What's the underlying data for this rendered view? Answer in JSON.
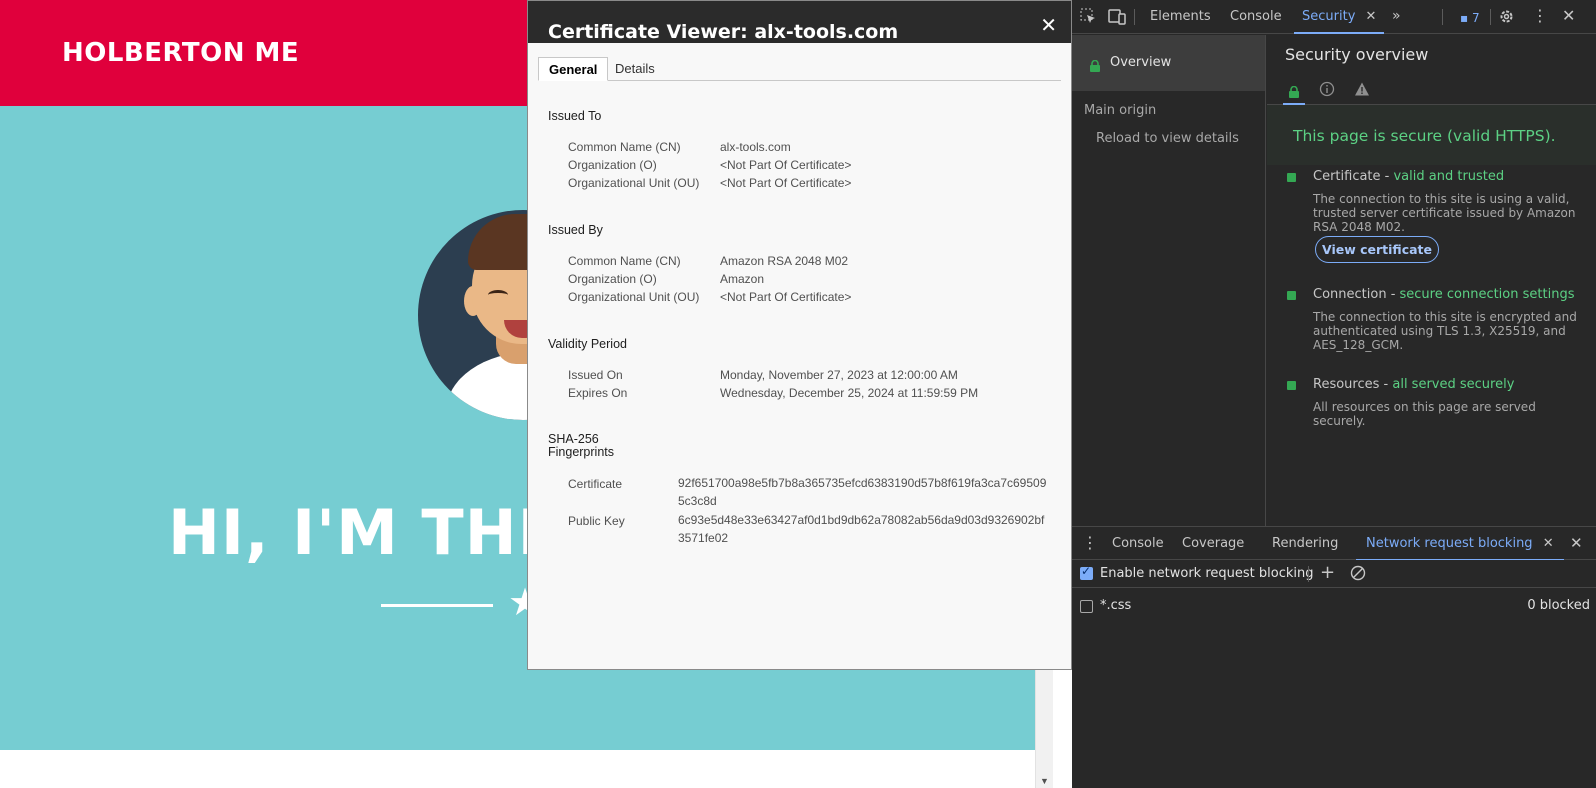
{
  "website": {
    "brand": "HOLBERTON ME",
    "hero_title": "HI, I'M THE"
  },
  "cert_viewer": {
    "title": "Certificate Viewer: alx-tools.com",
    "tabs": [
      "General",
      "Details"
    ],
    "issued_to": {
      "heading": "Issued To",
      "rows": [
        {
          "key": "Common Name (CN)",
          "value": "alx-tools.com"
        },
        {
          "key": "Organization (O)",
          "value": "<Not Part Of Certificate>"
        },
        {
          "key": "Organizational Unit (OU)",
          "value": "<Not Part Of Certificate>"
        }
      ]
    },
    "issued_by": {
      "heading": "Issued By",
      "rows": [
        {
          "key": "Common Name (CN)",
          "value": "Amazon RSA 2048 M02"
        },
        {
          "key": "Organization (O)",
          "value": "Amazon"
        },
        {
          "key": "Organizational Unit (OU)",
          "value": "<Not Part Of Certificate>"
        }
      ]
    },
    "validity": {
      "heading": "Validity Period",
      "rows": [
        {
          "key": "Issued On",
          "value": "Monday, November 27, 2023 at 12:00:00 AM"
        },
        {
          "key": "Expires On",
          "value": "Wednesday, December 25, 2024 at 11:59:59 PM"
        }
      ]
    },
    "fingerprints": {
      "heading_line1": "SHA-256",
      "heading_line2": "Fingerprints",
      "rows": [
        {
          "key": "Certificate",
          "value": "92f651700a98e5fb7b8a365735efcd6383190d57b8f619fa3ca7c695095c3c8d"
        },
        {
          "key": "Public Key",
          "value": "6c93e5d48e33e63427af0d1bd9db62a78082ab56da9d03d9326902bf3571fe02"
        }
      ]
    }
  },
  "devtools": {
    "tabs": [
      "Elements",
      "Console",
      "Security"
    ],
    "issues_count": "7",
    "sidebar": {
      "overview": "Overview",
      "main_origin": "Main origin",
      "reload": "Reload to view details"
    },
    "overview": {
      "title": "Security overview",
      "secure_message": "This page is secure (valid HTTPS).",
      "certificate": {
        "label": "Certificate - ",
        "status": "valid and trusted",
        "desc": "The connection to this site is using a valid, trusted server certificate issued by Amazon RSA 2048 M02.",
        "button": "View certificate"
      },
      "connection": {
        "label": "Connection - ",
        "status": "secure connection settings",
        "desc": "The connection to this site is encrypted and authenticated using TLS 1.3, X25519, and AES_128_GCM."
      },
      "resources": {
        "label": "Resources - ",
        "status": "all served securely",
        "desc": "All resources on this page are served securely."
      }
    },
    "drawer": {
      "tabs": [
        "Console",
        "Coverage",
        "Rendering",
        "Network request blocking"
      ],
      "enable_label": "Enable network request blocking",
      "enabled": true,
      "rules": [
        {
          "pattern": "*.css",
          "checked": false,
          "count": "0 blocked"
        }
      ]
    }
  },
  "colors": {
    "brand_red": "#e0003c",
    "hero_teal": "#76cdd2",
    "devtools_accent": "#7cacf8",
    "secure_green": "#5cd184"
  }
}
